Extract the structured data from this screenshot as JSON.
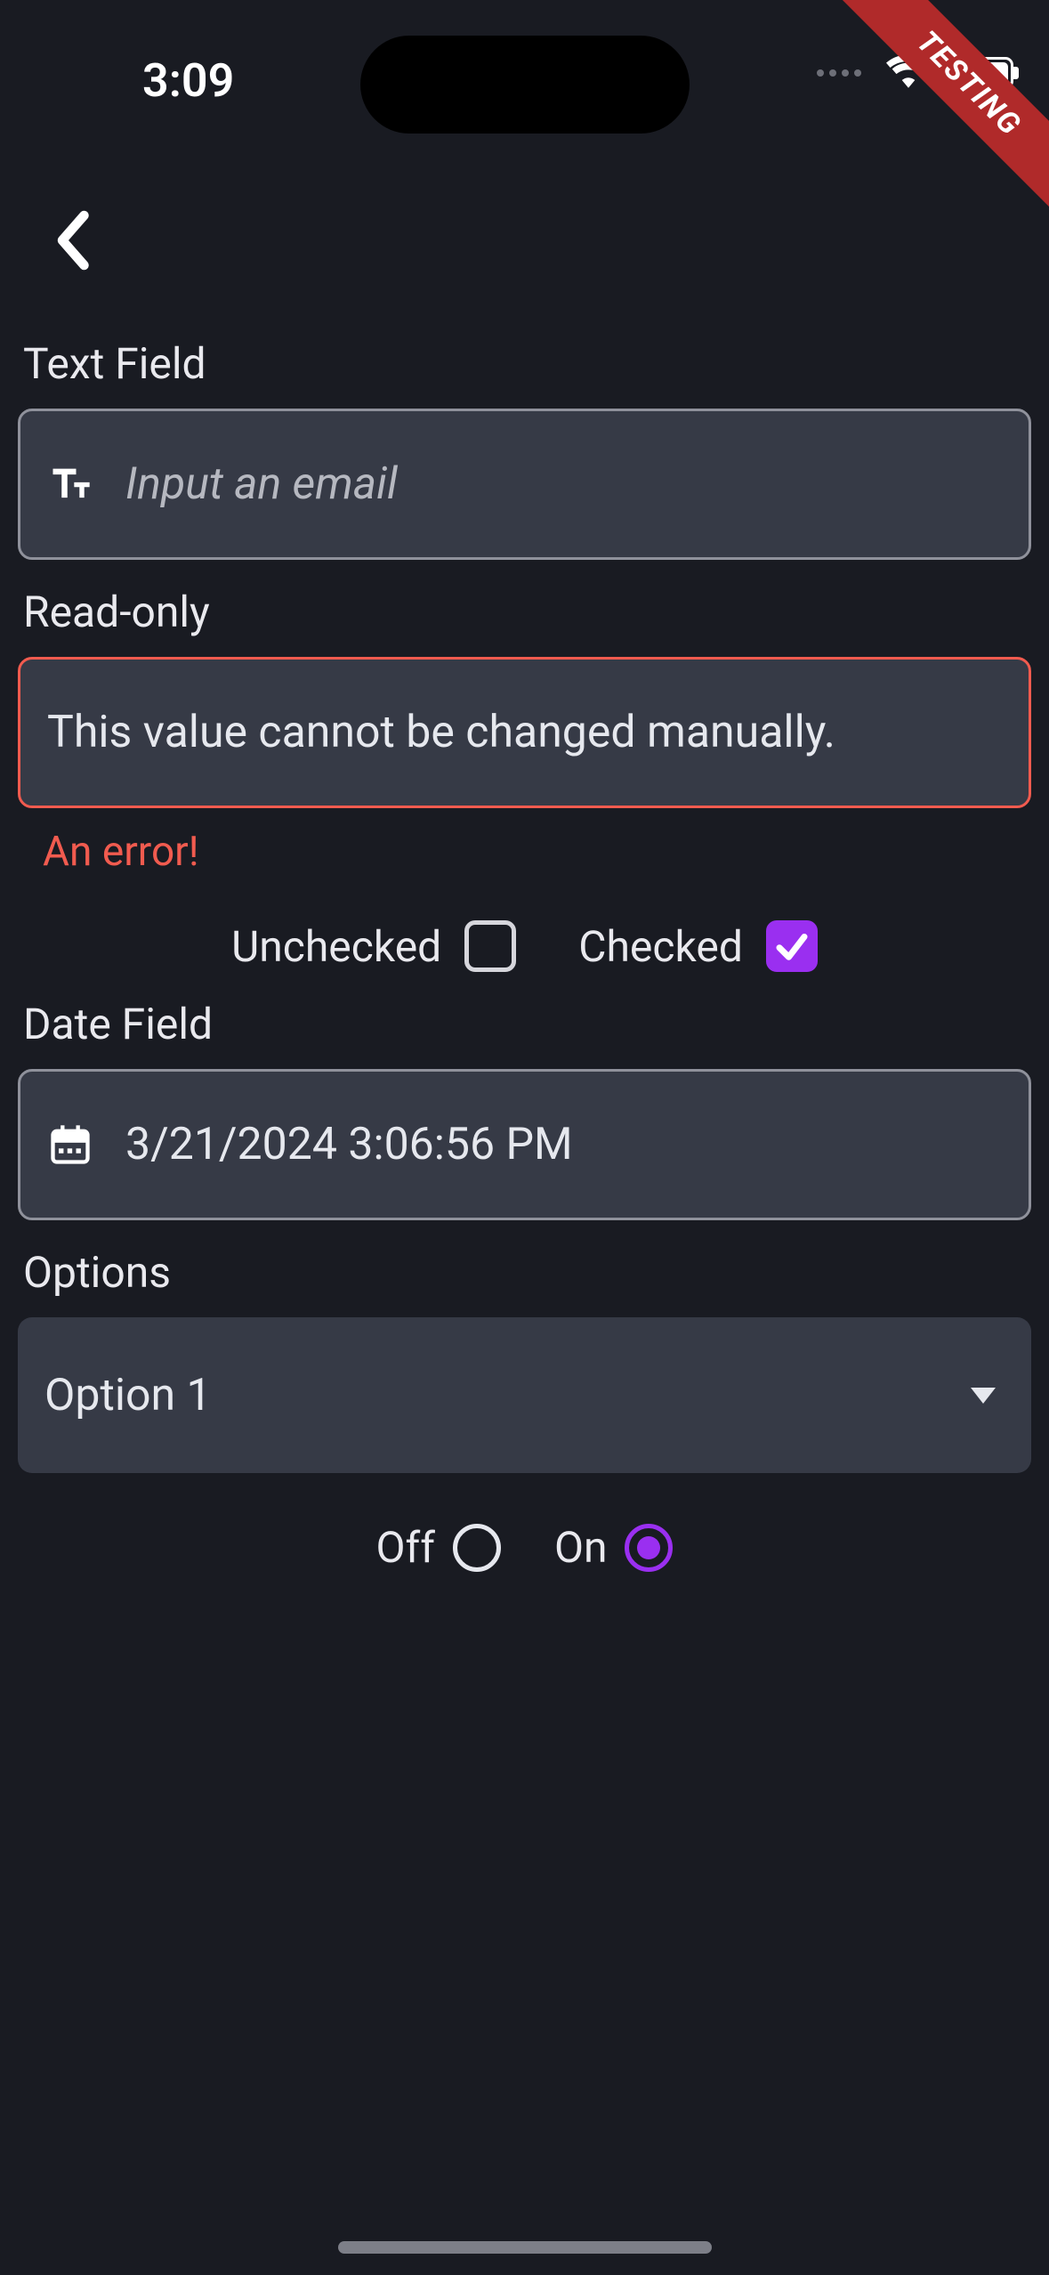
{
  "status": {
    "time": "3:09"
  },
  "ribbon": {
    "label": "TESTING"
  },
  "form": {
    "text_field": {
      "label": "Text Field",
      "placeholder": "Input an email"
    },
    "readonly_field": {
      "label": "Read-only",
      "value": "This value cannot be changed manually.",
      "error": "An error!"
    },
    "checkboxes": {
      "unchecked_label": "Unchecked",
      "checked_label": "Checked"
    },
    "date_field": {
      "label": "Date Field",
      "value": "3/21/2024 3:06:56 PM"
    },
    "options_field": {
      "label": "Options",
      "selected": "Option 1"
    },
    "radios": {
      "off_label": "Off",
      "on_label": "On"
    }
  }
}
